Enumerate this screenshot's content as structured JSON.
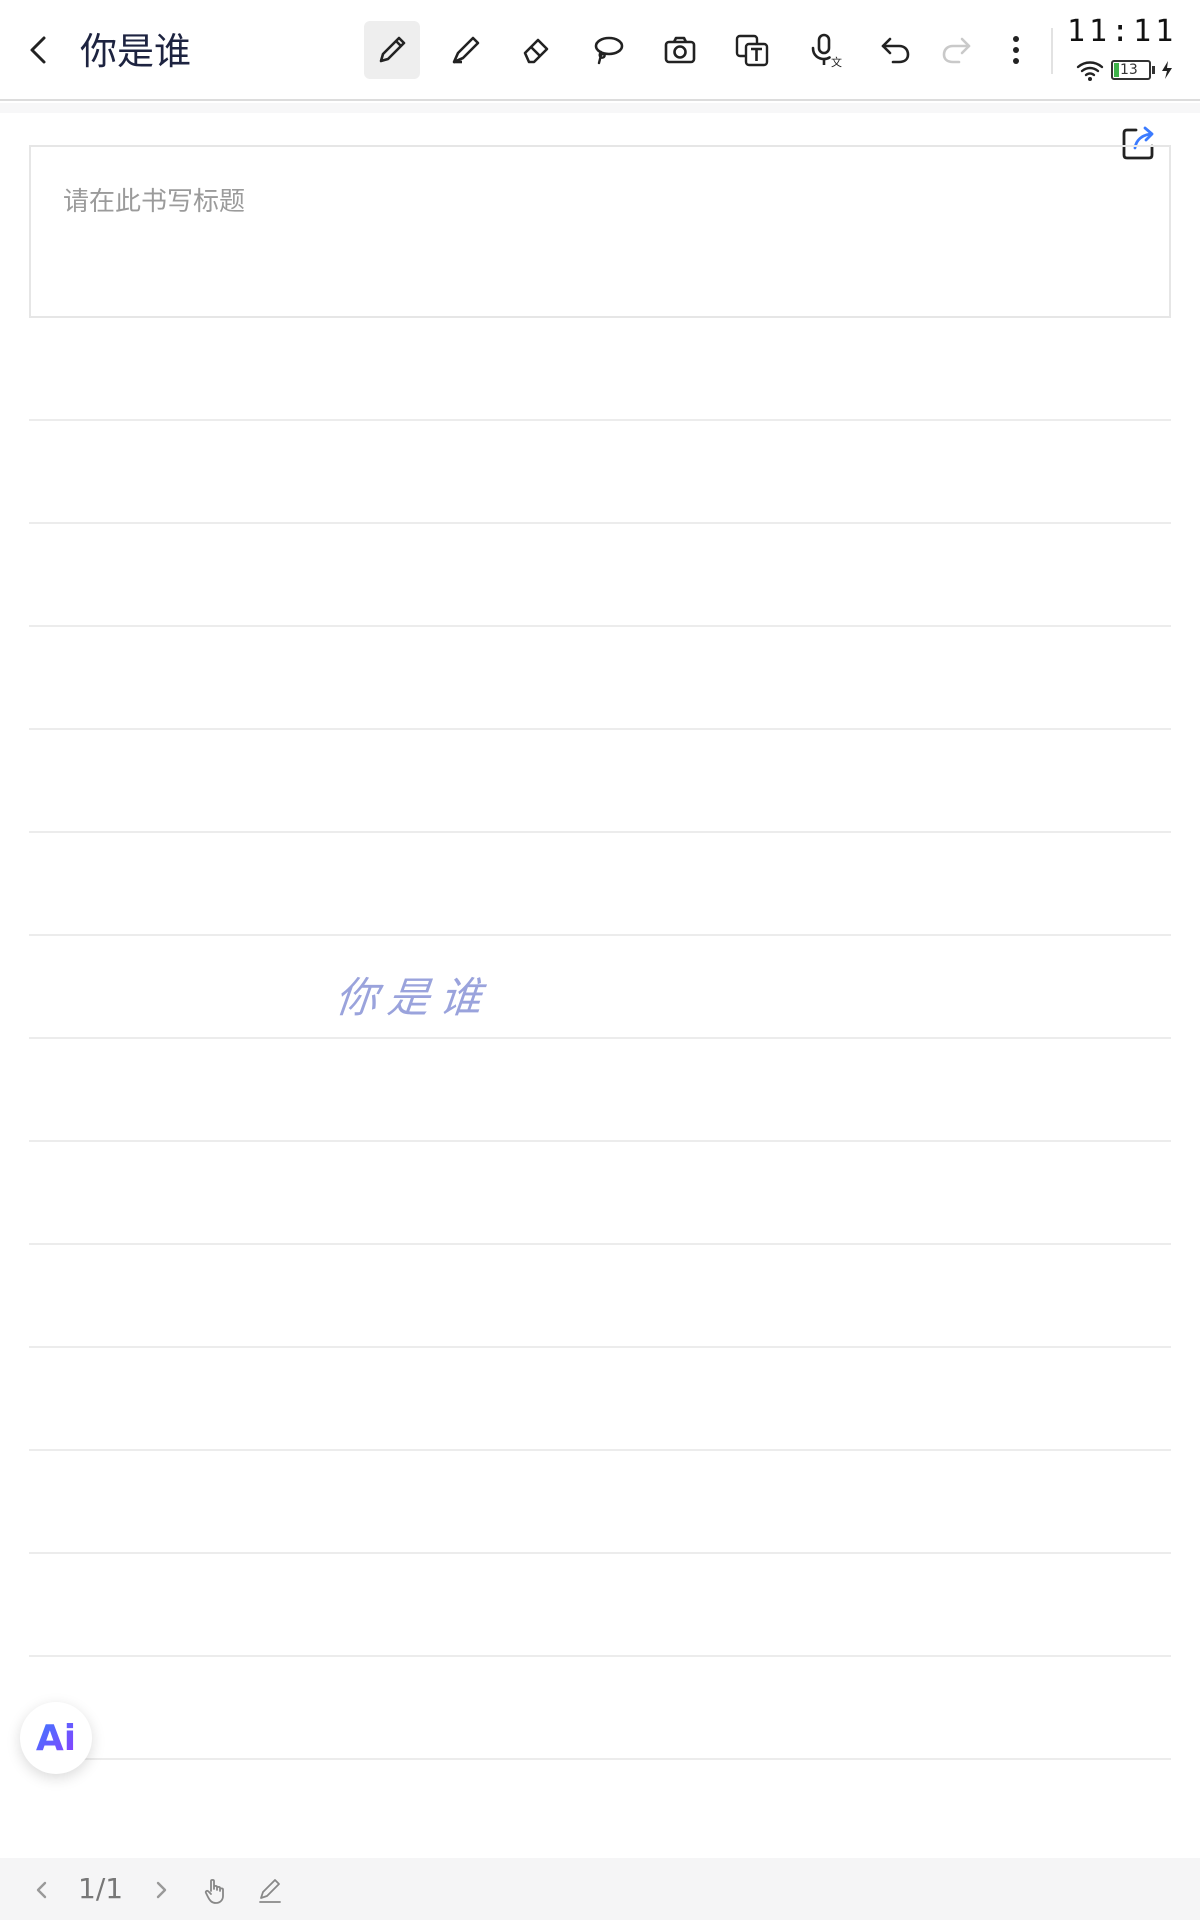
{
  "header": {
    "title": "你是谁",
    "back_icon": "chevron-left-icon"
  },
  "toolbar": {
    "tools": [
      {
        "name": "pen-tool",
        "icon": "pen-icon",
        "active": true
      },
      {
        "name": "highlighter-tool",
        "icon": "highlighter-icon",
        "active": false
      },
      {
        "name": "eraser-tool",
        "icon": "eraser-icon",
        "active": false
      },
      {
        "name": "lasso-tool",
        "icon": "lasso-icon",
        "active": false
      },
      {
        "name": "camera-tool",
        "icon": "camera-icon",
        "active": false
      },
      {
        "name": "text-recognition-tool",
        "icon": "text-convert-icon",
        "active": false
      },
      {
        "name": "voice-to-text-tool",
        "icon": "microphone-icon",
        "active": false
      },
      {
        "name": "undo-tool",
        "icon": "undo-icon",
        "active": false
      },
      {
        "name": "redo-tool",
        "icon": "redo-icon",
        "active": false,
        "disabled": true
      },
      {
        "name": "more-tool",
        "icon": "more-vertical-icon",
        "active": false
      }
    ]
  },
  "status": {
    "time": "11:11",
    "battery": "13",
    "wifi_icon": "wifi-icon",
    "charging_icon": "charging-icon"
  },
  "note": {
    "title_placeholder": "请在此书写标题",
    "handwriting_text": "你是谁",
    "handwriting_color": "#9aa3dc"
  },
  "ai_button": {
    "label": "Ai"
  },
  "footer": {
    "page_indicator": "1/1"
  },
  "colors": {
    "accent": "#3b7bff",
    "ai_gradient_end": "#8f3cff",
    "battery_green": "#3fb24a"
  }
}
